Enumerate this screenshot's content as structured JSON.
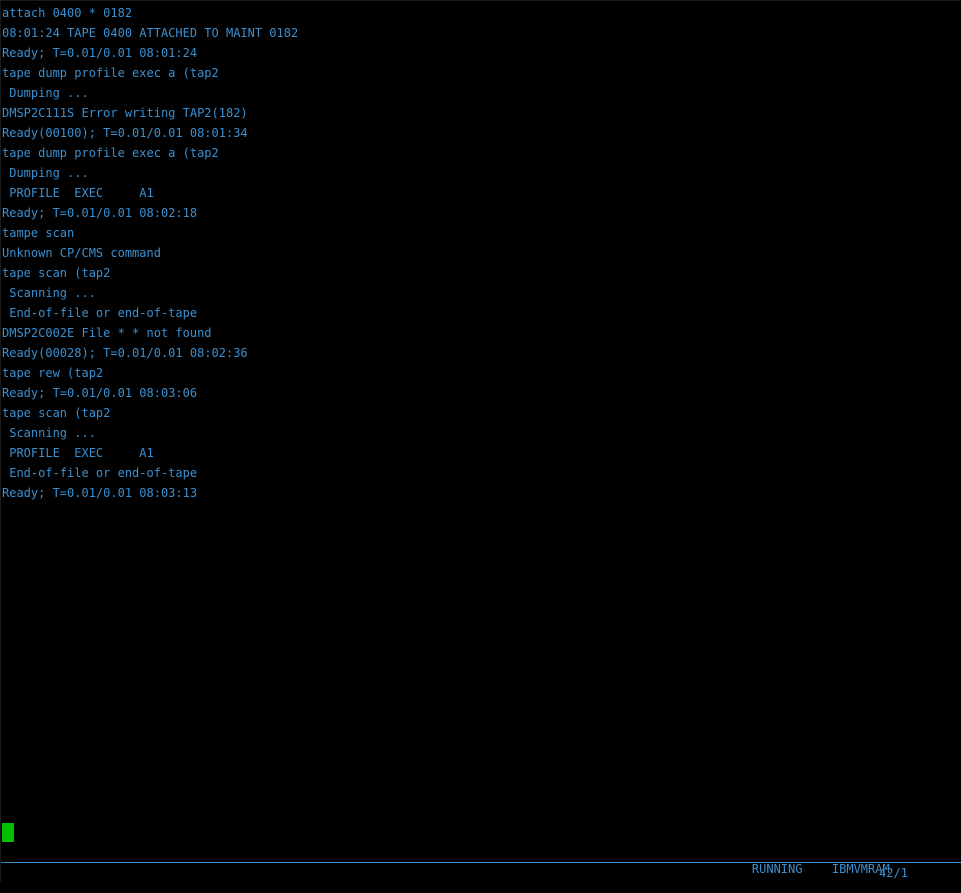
{
  "terminal": {
    "lines": [
      "attach 0400 * 0182",
      "08:01:24 TAPE 0400 ATTACHED TO MAINT 0182",
      "Ready; T=0.01/0.01 08:01:24",
      "tape dump profile exec a (tap2",
      " Dumping ...",
      "DMSP2C111S Error writing TAP2(182)",
      "Ready(00100); T=0.01/0.01 08:01:34",
      "tape dump profile exec a (tap2",
      " Dumping ...",
      " PROFILE  EXEC     A1",
      "Ready; T=0.01/0.01 08:02:18",
      "tampe scan",
      "Unknown CP/CMS command",
      "tape scan (tap2",
      " Scanning ...",
      " End-of-file or end-of-tape",
      "DMSP2C002E File * * not found",
      "Ready(00028); T=0.01/0.01 08:02:36",
      "tape rew (tap2",
      "Ready; T=0.01/0.01 08:03:06",
      "tape scan (tap2",
      " Scanning ...",
      " PROFILE  EXEC     A1",
      " End-of-file or end-of-tape",
      "Ready; T=0.01/0.01 08:03:13"
    ]
  },
  "status": {
    "state": "RUNNING",
    "system": "IBMVMRAM"
  },
  "oia": {
    "cursor_position": "42/1"
  },
  "colors": {
    "text": "#3a8fd0",
    "background": "#000000",
    "cursor": "#00c000"
  }
}
